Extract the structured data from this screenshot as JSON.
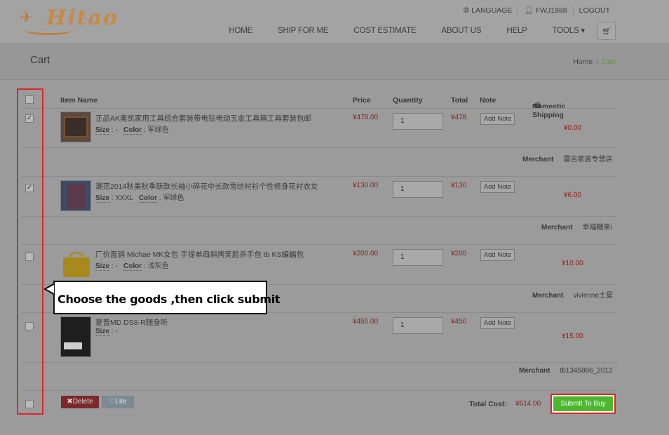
{
  "header": {
    "logo_text": "Hitao",
    "top_links": [
      "LANGUAGE",
      "FWJ1988",
      "LOGOUT"
    ],
    "nav": [
      "HOME",
      "SHIP FOR ME",
      "COST ESTIMATE",
      "ABOUT US",
      "HELP",
      "TOOLS"
    ]
  },
  "page": {
    "title": "Cart",
    "breadcrumb": {
      "home": "Home",
      "sep": "/",
      "current": "Cart"
    }
  },
  "table": {
    "headers": {
      "item_name": "Item Name",
      "price": "Price",
      "quantity": "Quantity",
      "total": "Total",
      "note": "Note",
      "domestic_shipping": "Domestic Shipping"
    },
    "size_label": "Size",
    "color_label": "Color",
    "merchant_label": "Merchant",
    "add_note_label": "Add Note",
    "items": [
      {
        "checked": true,
        "name": "正品AK奥凯家用工具组合套装带电钻电动五金工具箱工具套装包邮",
        "size": "-",
        "color": "军绿色",
        "price": "¥478.00",
        "quantity": "1",
        "total": "¥478",
        "shipping": "¥0.00",
        "merchant": "雷吉家居专营店"
      },
      {
        "checked": true,
        "name": "潮范2014秋美秋季新款长袖小碎花中长款雪纺衬衫个性修身花衬衣女",
        "size": "XXXL",
        "color": "军绿色",
        "price": "¥130.00",
        "quantity": "1",
        "total": "¥130",
        "shipping": "¥6.00",
        "merchant": "幸福糖果i"
      },
      {
        "checked": false,
        "name": "厂价直销 Michae MK女包 手提单肩斜挎笑脸杀手包 tb KS蝙蝠包",
        "size": "-",
        "color": "浅灰色",
        "price": "¥200.00",
        "quantity": "1",
        "total": "¥200",
        "shipping": "¥10.00",
        "merchant": "vivienne土星"
      },
      {
        "checked": false,
        "name": "夏普MD DS8-R随身听",
        "size": "-",
        "color": "",
        "price": "¥450.00",
        "quantity": "1",
        "total": "¥450",
        "shipping": "¥15.00",
        "merchant": "tb1345866_2012"
      }
    ]
  },
  "footer": {
    "delete_label": "Delete",
    "lite_label": "Lite",
    "total_cost_label": "Total Cost:",
    "total_cost_value": "¥614.00",
    "submit_label": "Submit To Buy"
  },
  "annotation": {
    "callout_text": "Choose the goods ,then click submit"
  },
  "colors": {
    "accent_red": "#e0242e",
    "submit_green": "#4cb82e",
    "price_red": "#8b1e1e"
  }
}
